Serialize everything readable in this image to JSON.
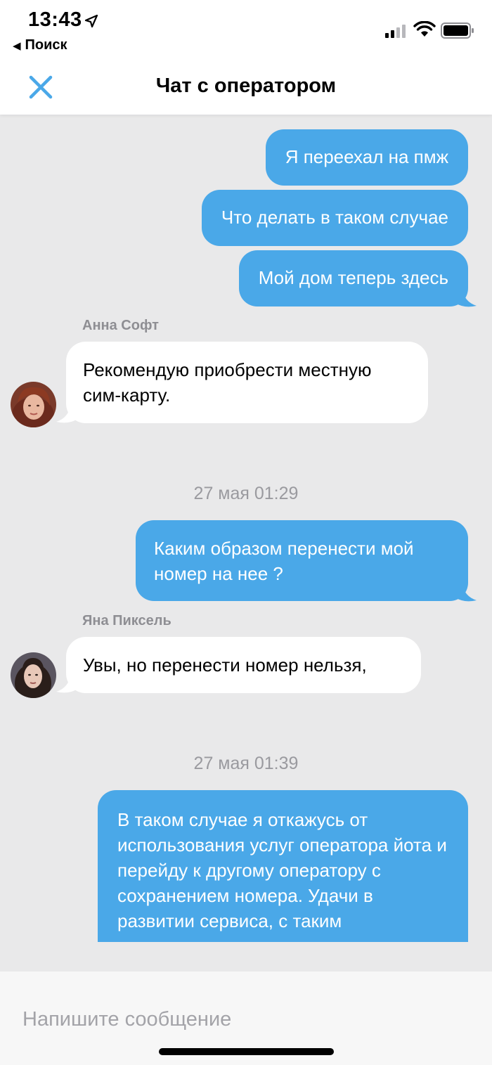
{
  "status_bar": {
    "time": "13:43",
    "back_app": "Поиск",
    "icons": [
      "location-arrow-icon",
      "signal-icon",
      "wifi-icon",
      "battery-icon"
    ]
  },
  "header": {
    "title": "Чат с оператором",
    "close_icon": "close-icon"
  },
  "colors": {
    "outgoing_bubble": "#4aa8e8",
    "incoming_bubble": "#ffffff",
    "background": "#e9e9ea",
    "accent": "#4aa8e8"
  },
  "messages": [
    {
      "direction": "out",
      "text": "Я переехал на пмж"
    },
    {
      "direction": "out",
      "text": "Что делать в таком случае"
    },
    {
      "direction": "out",
      "text": "Мой дом теперь здесь"
    },
    {
      "direction": "in",
      "sender": "Анна Софт",
      "text": "Рекомендую приобрести местную сим-карту."
    },
    {
      "type": "date",
      "text": "27 мая 01:29"
    },
    {
      "direction": "out",
      "text": "Каким образом перенести мой номер на нее ?"
    },
    {
      "direction": "in",
      "sender": "Яна Пиксель",
      "text": "Увы, но перенести номер нельзя,"
    },
    {
      "type": "date",
      "text": "27 мая 01:39"
    },
    {
      "direction": "out",
      "text": "В таком случае я откажусь от использования услуг оператора йота и перейду к другому оператору с сохранением номера. Удачи в развитии сервиса, с таким отношением к своим"
    }
  ],
  "composer": {
    "placeholder": "Напишите сообщение"
  }
}
